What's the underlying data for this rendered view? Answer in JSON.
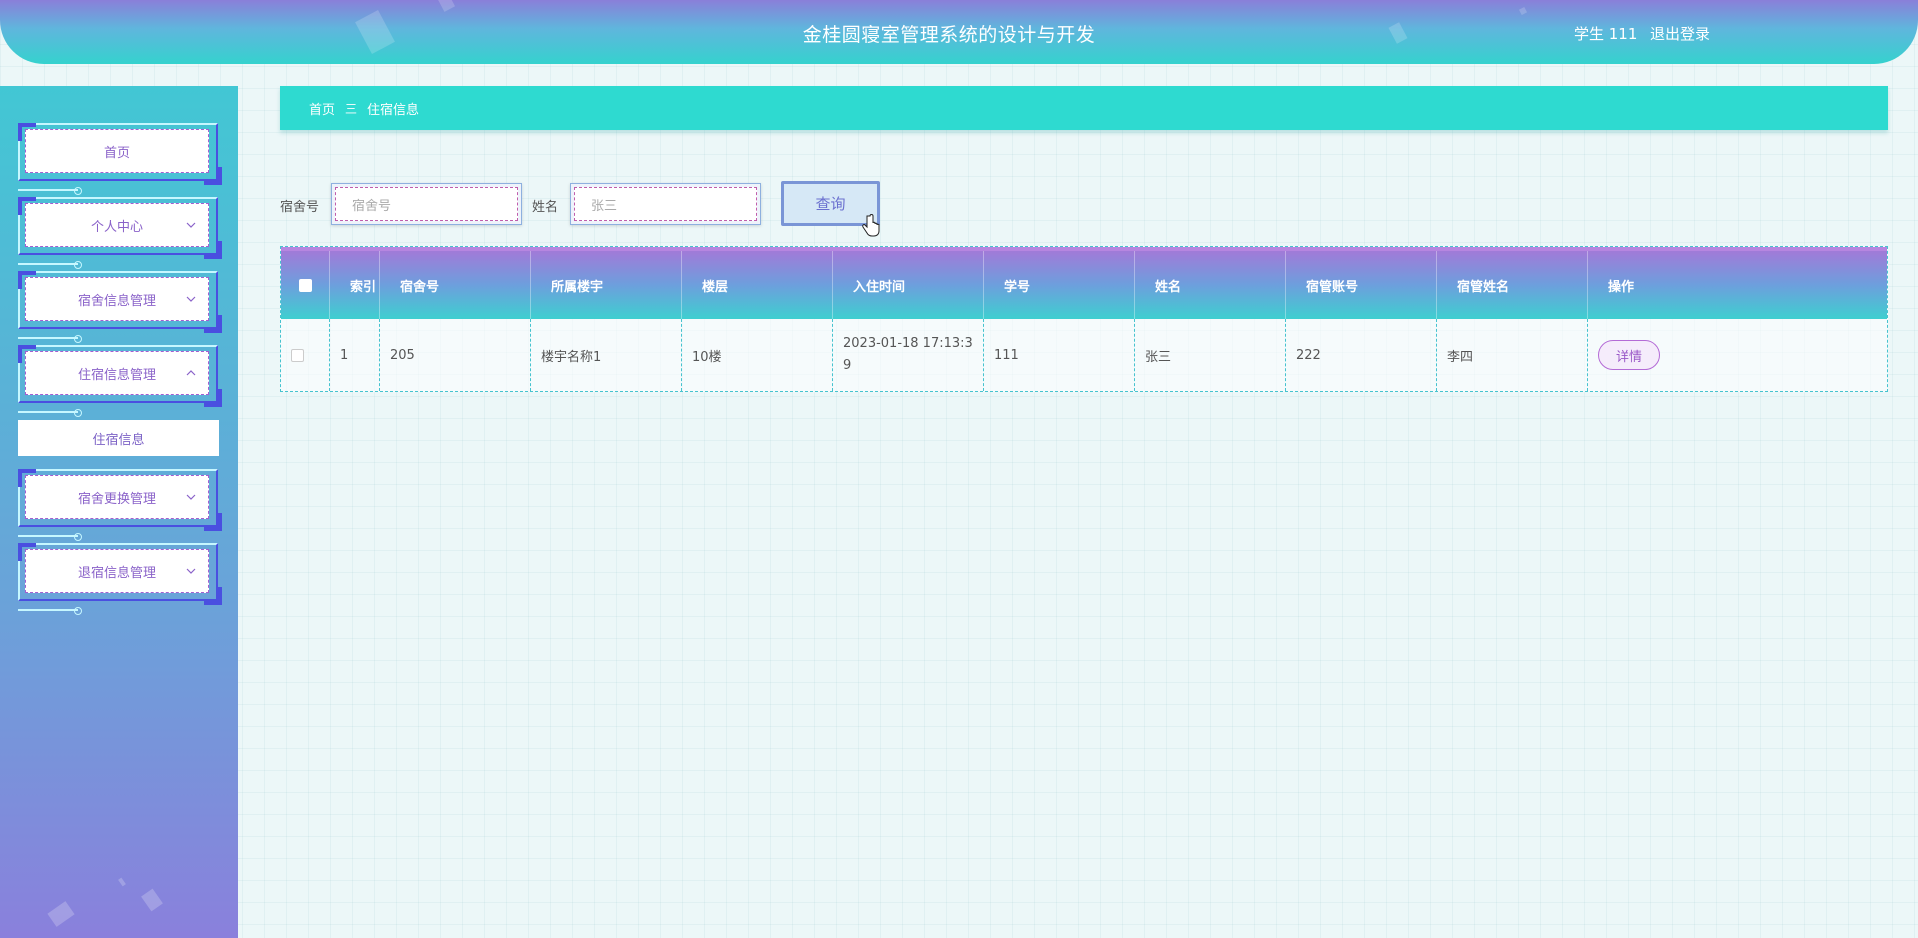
{
  "header": {
    "title": "金桂圆寝室管理系统的设计与开发",
    "user": "学生 111",
    "logout": "退出登录"
  },
  "sidebar": {
    "items": [
      {
        "label": "首页",
        "has_chevron": false
      },
      {
        "label": "个人中心",
        "chevron": "down"
      },
      {
        "label": "宿舍信息管理",
        "chevron": "down"
      },
      {
        "label": "住宿信息管理",
        "chevron": "up"
      },
      {
        "label": "宿舍更换管理",
        "chevron": "down"
      },
      {
        "label": "退宿信息管理",
        "chevron": "down"
      }
    ],
    "submenu_label": "住宿信息"
  },
  "breadcrumb": {
    "home": "首页",
    "separator": "三",
    "current": "住宿信息"
  },
  "search": {
    "room_label": "宿舍号",
    "room_placeholder": "宿舍号",
    "name_label": "姓名",
    "name_placeholder": "张三",
    "query_button": "查询"
  },
  "table": {
    "columns": [
      "索引",
      "宿舍号",
      "所属楼宇",
      "楼层",
      "入住时间",
      "学号",
      "姓名",
      "宿管账号",
      "宿管姓名",
      "操作"
    ],
    "rows": [
      {
        "index": "1",
        "room": "205",
        "building": "楼宇名称1",
        "floor": "10楼",
        "checkin_time_line1": "2023-01-18 17:13:3",
        "checkin_time_line2": "9",
        "student_id": "111",
        "name": "张三",
        "manager_account": "222",
        "manager_name": "李四",
        "action": "详情"
      }
    ]
  },
  "colors": {
    "header_gradient_top": "#8a7fd9",
    "header_gradient_bottom": "#35d2ce",
    "breadcrumb_bg": "#2edad0",
    "accent_purple": "#9a58c8",
    "table_border": "#46c3cf"
  }
}
